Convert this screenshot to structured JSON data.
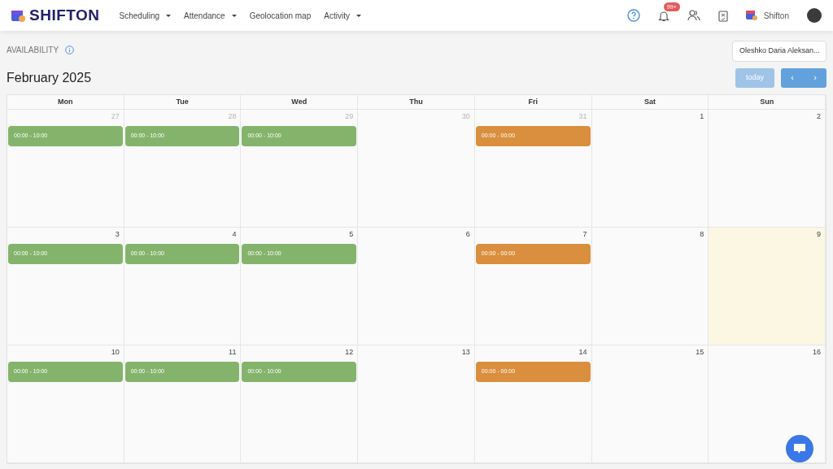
{
  "navbar": {
    "brand": "SHIFTON",
    "menu": [
      {
        "label": "Scheduling",
        "dropdown": true
      },
      {
        "label": "Attendance",
        "dropdown": true
      },
      {
        "label": "Geolocation map",
        "dropdown": false
      },
      {
        "label": "Activity",
        "dropdown": true
      }
    ],
    "notifications_badge": "99+",
    "company": "Shifton"
  },
  "page": {
    "title": "AVAILABILITY",
    "employee_select": "Oleshko Daria Aleksan...",
    "month": "February 2025",
    "today_button": {
      "label": "today",
      "disabled": true
    },
    "prev": "‹",
    "next": "›"
  },
  "calendar": {
    "weekdays": [
      "Mon",
      "Tue",
      "Wed",
      "Thu",
      "Fri",
      "Sat",
      "Sun"
    ],
    "weeks": [
      [
        {
          "number": "27",
          "other_month": true,
          "today": false,
          "events": [
            {
              "time": "00:00 - 10:00",
              "color": "#84b46b"
            }
          ]
        },
        {
          "number": "28",
          "other_month": true,
          "today": false,
          "events": [
            {
              "time": "00:00 - 10:00",
              "color": "#84b46b"
            }
          ]
        },
        {
          "number": "29",
          "other_month": true,
          "today": false,
          "events": [
            {
              "time": "00:00 - 10:00",
              "color": "#84b46b"
            }
          ]
        },
        {
          "number": "30",
          "other_month": true,
          "today": false
        },
        {
          "number": "31",
          "other_month": true,
          "today": false,
          "events": [
            {
              "time": "00:00 - 00:00",
              "color": "#d98f3d"
            }
          ]
        },
        {
          "number": "1",
          "other_month": false,
          "today": false
        },
        {
          "number": "2",
          "other_month": false,
          "today": false
        }
      ],
      [
        {
          "number": "3",
          "other_month": false,
          "today": false,
          "events": [
            {
              "time": "00:00 - 10:00",
              "color": "#84b46b"
            }
          ]
        },
        {
          "number": "4",
          "other_month": false,
          "today": false,
          "events": [
            {
              "time": "00:00 - 10:00",
              "color": "#84b46b"
            }
          ]
        },
        {
          "number": "5",
          "other_month": false,
          "today": false,
          "events": [
            {
              "time": "00:00 - 10:00",
              "color": "#84b46b"
            }
          ]
        },
        {
          "number": "6",
          "other_month": false,
          "today": false
        },
        {
          "number": "7",
          "other_month": false,
          "today": false,
          "events": [
            {
              "time": "00:00 - 00:00",
              "color": "#d98f3d"
            }
          ]
        },
        {
          "number": "8",
          "other_month": false,
          "today": false
        },
        {
          "number": "9",
          "other_month": false,
          "today": true
        }
      ],
      [
        {
          "number": "10",
          "other_month": false,
          "today": false,
          "events": [
            {
              "time": "00:00 - 10:00",
              "color": "#84b46b"
            }
          ]
        },
        {
          "number": "11",
          "other_month": false,
          "today": false,
          "events": [
            {
              "time": "00:00 - 10:00",
              "color": "#84b46b"
            }
          ]
        },
        {
          "number": "12",
          "other_month": false,
          "today": false,
          "events": [
            {
              "time": "00:00 - 10:00",
              "color": "#84b46b"
            }
          ]
        },
        {
          "number": "13",
          "other_month": false,
          "today": false
        },
        {
          "number": "14",
          "other_month": false,
          "today": false,
          "events": [
            {
              "time": "00:00 - 00:00",
              "color": "#d98f3d"
            }
          ]
        },
        {
          "number": "15",
          "other_month": false,
          "today": false
        },
        {
          "number": "16",
          "other_month": false,
          "today": false
        }
      ]
    ]
  }
}
